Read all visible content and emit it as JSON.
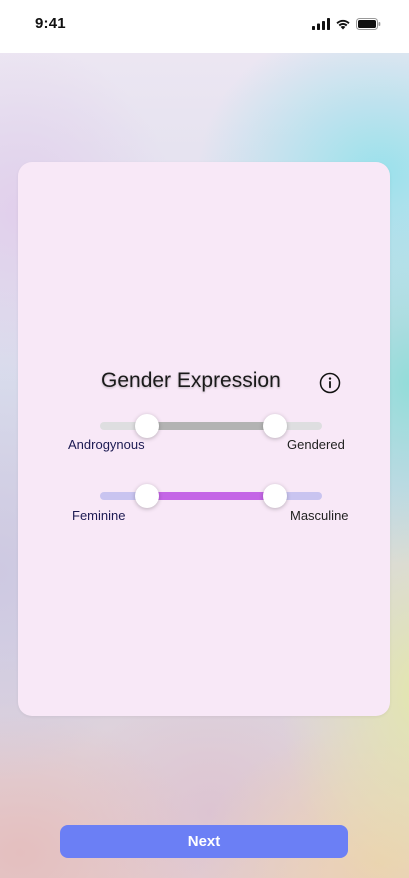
{
  "status_bar": {
    "time": "9:41",
    "icons": [
      "cellular-signal-icon",
      "wifi-icon",
      "battery-icon"
    ]
  },
  "card": {
    "title": "Gender Expression",
    "info_icon": "info-icon"
  },
  "sliders": [
    {
      "name": "androgynous-gendered",
      "min_label": "Androgynous",
      "max_label": "Gendered",
      "range_low": 0.21,
      "range_high": 0.79,
      "track_color": "#dedee0",
      "fill_color": "#b3b3b3"
    },
    {
      "name": "feminine-masculine",
      "min_label": "Feminine",
      "max_label": "Masculine",
      "range_low": 0.21,
      "range_high": 0.79,
      "track_color": "#c9c4f0",
      "fill_color": "#c466e6"
    }
  ],
  "next_button": {
    "label": "Next",
    "color": "#6b7ff5"
  }
}
